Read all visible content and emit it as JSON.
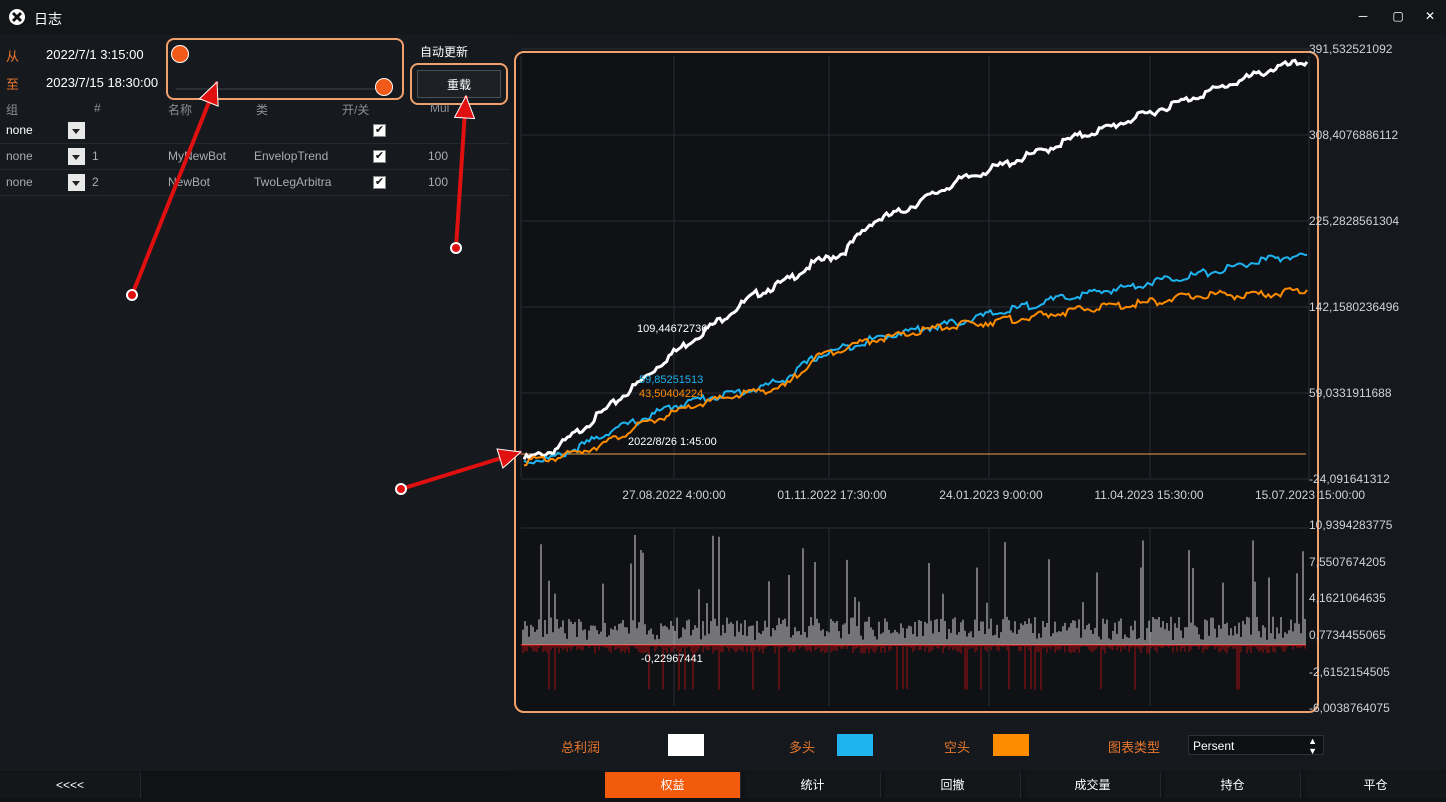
{
  "window": {
    "title": "日志"
  },
  "range": {
    "from_label": "从",
    "from_value": "2022/7/1 3:15:00",
    "to_label": "至",
    "to_value": "2023/7/15 18:30:00"
  },
  "controls": {
    "auto_update": "自动更新",
    "reload": "重载"
  },
  "table": {
    "headers": [
      "组",
      "#",
      "名称",
      "类",
      "开/关",
      "Mul"
    ],
    "rows": [
      {
        "group": "none",
        "num": "",
        "name": "",
        "cls": "",
        "on": true,
        "mul": ""
      },
      {
        "group": "none",
        "num": "1",
        "name": "MyNewBot",
        "cls": "EnvelopTrend",
        "on": true,
        "mul": "100"
      },
      {
        "group": "none",
        "num": "2",
        "name": "NewBot",
        "cls": "TwoLegArbitra",
        "on": true,
        "mul": "100"
      }
    ]
  },
  "chart_data": [
    {
      "type": "line",
      "x_ticks": [
        "27.08.2022 4:00:00",
        "01.11.2022 17:30:00",
        "24.01.2023 9:00:00",
        "11.04.2023 15:30:00",
        "15.07.2023 15:00:00"
      ],
      "y_ticks": [
        "391,532521092",
        "308,4076886112",
        "225,2828561304",
        "142,1580236496",
        "59,0331911688",
        "-24,091641312"
      ],
      "ylim": [
        -24.091641312,
        391.532521092
      ],
      "series": [
        {
          "name": "总利润",
          "color": "#ffffff",
          "values": [
            0,
            8,
            30,
            52,
            75,
            100,
            120,
            140,
            160,
            172,
            190,
            200,
            230,
            240,
            255,
            270,
            280,
            290,
            300,
            312,
            320,
            330,
            340,
            350,
            360,
            370,
            380,
            385
          ]
        },
        {
          "name": "多头",
          "color": "#1fb3f0",
          "values": [
            0,
            3,
            15,
            30,
            40,
            52,
            60,
            65,
            70,
            80,
            100,
            110,
            118,
            125,
            130,
            135,
            142,
            148,
            155,
            160,
            165,
            170,
            176,
            180,
            185,
            192,
            197,
            200
          ]
        },
        {
          "name": "空头",
          "color": "#ff8c00",
          "values": [
            0,
            3,
            10,
            20,
            35,
            45,
            55,
            62,
            68,
            72,
            100,
            110,
            118,
            122,
            128,
            132,
            135,
            138,
            142,
            146,
            150,
            152,
            156,
            160,
            162,
            160,
            163,
            166
          ]
        }
      ],
      "annotations": [
        "109,44672736",
        "59,85251513",
        "43,50404224",
        "2022/8/26 1:45:00"
      ]
    },
    {
      "type": "bar",
      "y_ticks": [
        "10,9394283775",
        "7,5507674205",
        "4,1621064635",
        "0,7734455065",
        "-2,6152154505",
        "-6,0038764075"
      ],
      "ylim": [
        -6.0038764075,
        10.9394283775
      ],
      "annotations": [
        "-0,22967441"
      ]
    }
  ],
  "legend": [
    {
      "label": "总利润",
      "color": "#ffffff"
    },
    {
      "label": "多头",
      "color": "#1fb3f0"
    },
    {
      "label": "空头",
      "color": "#ff8c00"
    }
  ],
  "chart_type": {
    "label": "图表类型",
    "value": "Persent"
  },
  "tabs": {
    "collapse": "<<<<",
    "items": [
      "权益",
      "统计",
      "回撤",
      "成交量",
      "持仓",
      "平仓"
    ]
  }
}
